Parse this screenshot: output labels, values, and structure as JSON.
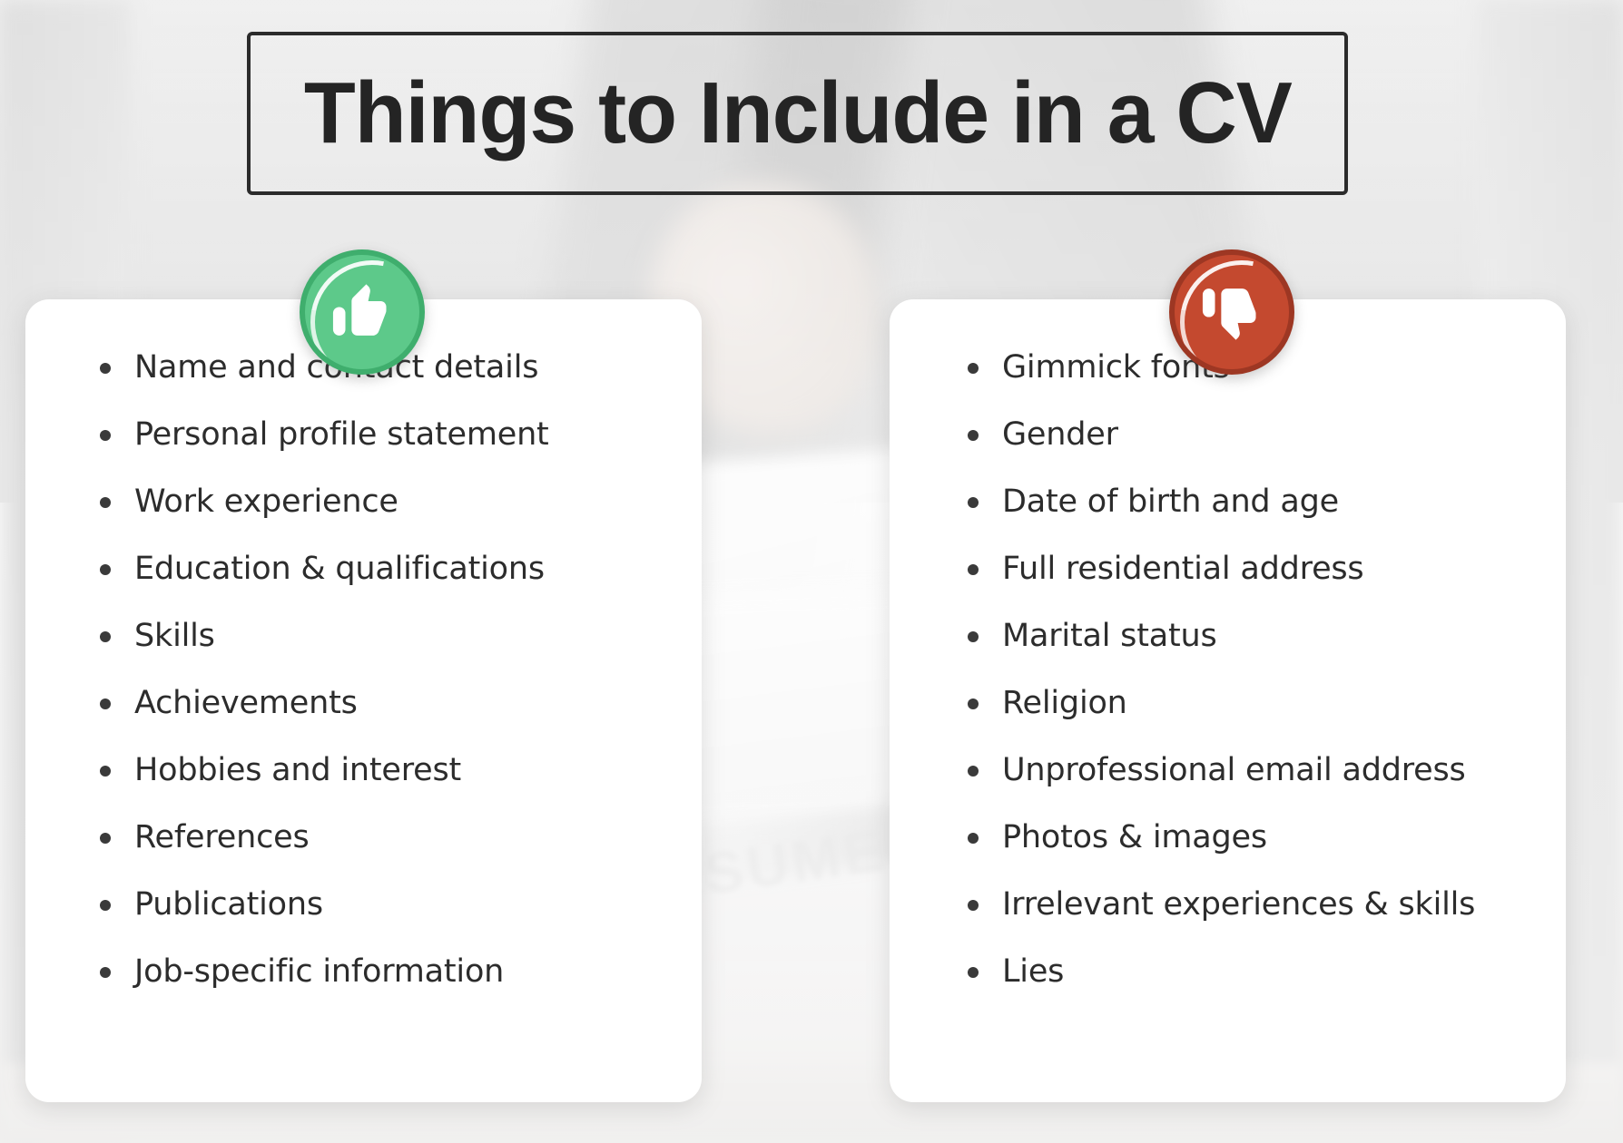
{
  "page": {
    "title": "Things to Include in a CV",
    "background_description": "blurred-office-desk-photo"
  },
  "colors": {
    "title_text": "#242424",
    "title_border": "#2b2b2b",
    "card_background": "#ffffff",
    "list_text": "#2c2c2c",
    "bullet": "#3a3a3a",
    "include_badge": "#5dc98a",
    "include_badge_ring": "#3fae6d",
    "avoid_badge": "#c4492f",
    "avoid_badge_ring": "#9d3723",
    "page_background": "#dcdcdc"
  },
  "include_card": {
    "badge_icon": "thumbs-up-icon",
    "items": [
      "Name and contact details",
      "Personal profile statement",
      "Work experience",
      "Education & qualifications",
      "Skills",
      "Achievements",
      "Hobbies and interest",
      "References",
      "Publications",
      "Job-specific information"
    ]
  },
  "avoid_card": {
    "badge_icon": "thumbs-down-icon",
    "items": [
      "Gimmick fonts",
      "Gender",
      "Date of birth and age",
      "Full residential address",
      "Marital status",
      "Religion",
      "Unprofessional email address",
      "Photos & images",
      "Irrelevant experiences & skills",
      "Lies"
    ]
  }
}
